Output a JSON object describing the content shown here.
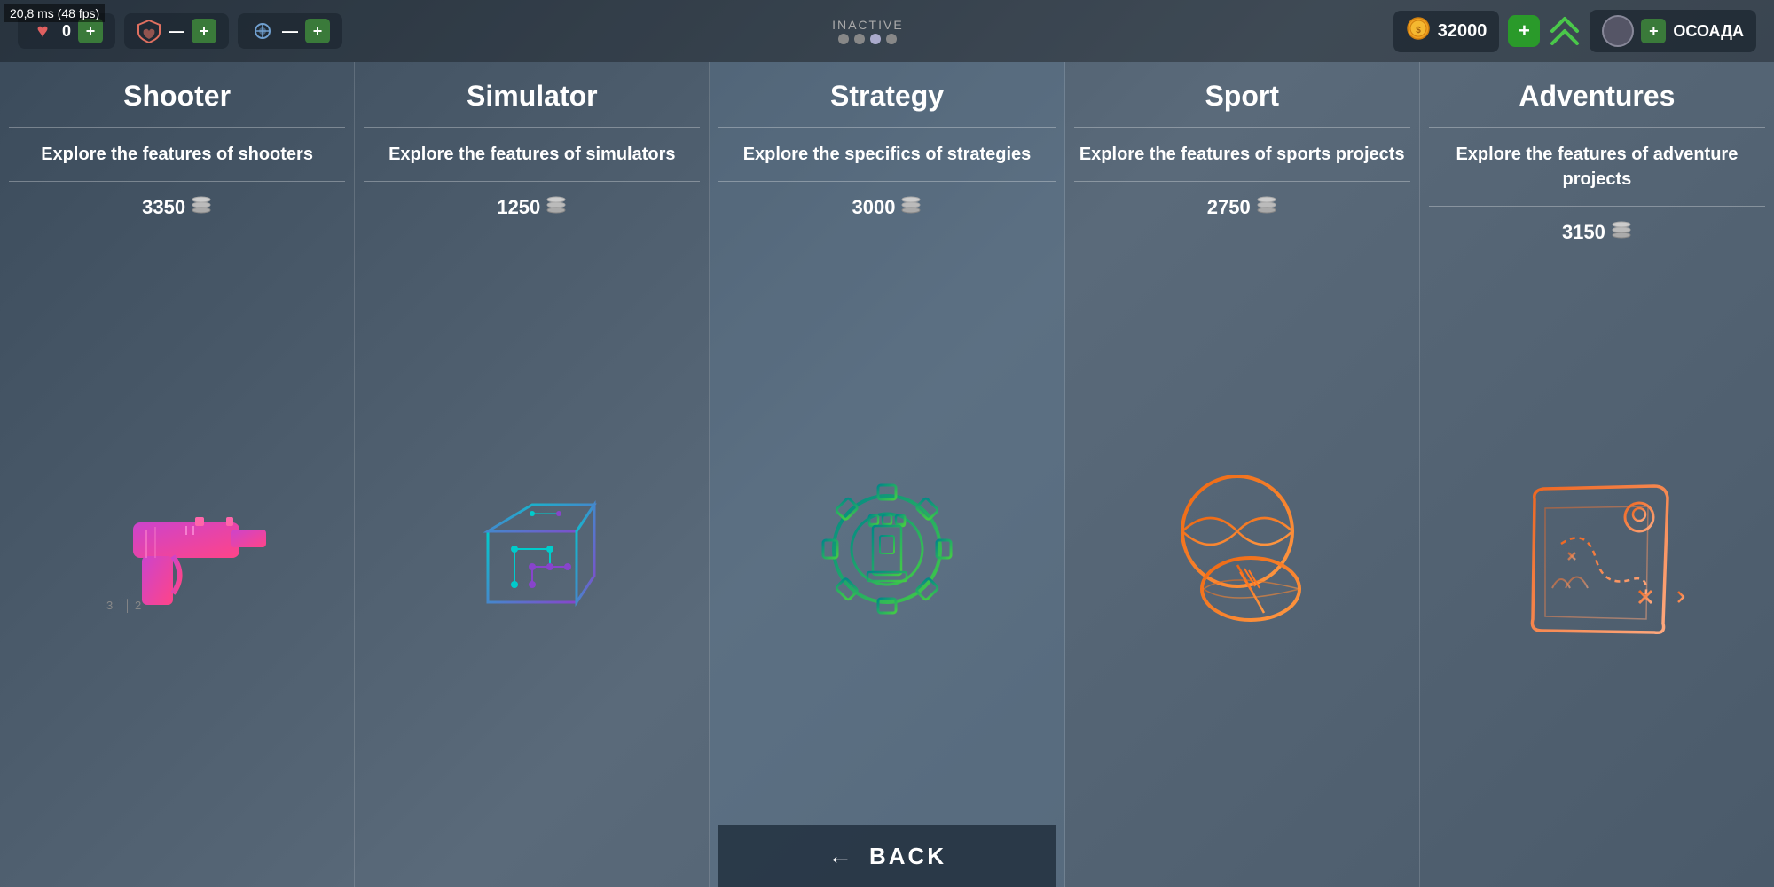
{
  "fps": "20,8 ms (48 fps)",
  "hud": {
    "health": {
      "value": "0",
      "icon": "♥"
    },
    "shield": {
      "icon": "❤"
    },
    "gems": {
      "icon": "◈"
    },
    "inactive_label": "INACTIVE",
    "add_label": "+",
    "coins": {
      "value": "32000",
      "icon": "🪙"
    },
    "username": "ОСОАДА"
  },
  "categories": [
    {
      "id": "shooter",
      "title": "Shooter",
      "description": "Explore the features of shooters",
      "price": "3350",
      "active": false
    },
    {
      "id": "simulator",
      "title": "Simulator",
      "description": "Explore the features of simulators",
      "price": "1250",
      "active": false
    },
    {
      "id": "strategy",
      "title": "Strategy",
      "description": "Explore the specifics of strategies",
      "price": "3000",
      "active": true
    },
    {
      "id": "sport",
      "title": "Sport",
      "description": "Explore the features of sports projects",
      "price": "2750",
      "active": false
    },
    {
      "id": "adventure",
      "title": "Adventures",
      "description": "Explore the features of adventure projects",
      "price": "3150",
      "active": false
    }
  ],
  "back_button": {
    "label": "BACK",
    "arrow": "←"
  }
}
